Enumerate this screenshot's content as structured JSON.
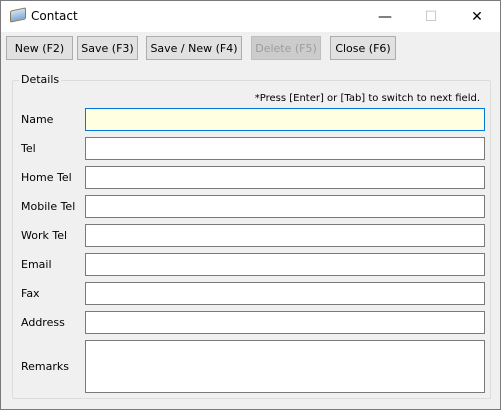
{
  "window": {
    "title": "Contact",
    "minimize": "—",
    "maximize": "☐",
    "close": "✕"
  },
  "toolbar": {
    "new": "New (F2)",
    "save": "Save (F3)",
    "save_new": "Save / New (F4)",
    "delete": "Delete (F5)",
    "close": "Close (F6)"
  },
  "details": {
    "legend": "Details",
    "hint": "*Press [Enter] or [Tab] to switch to next field.",
    "fields": [
      {
        "label": "Name",
        "value": ""
      },
      {
        "label": "Tel",
        "value": ""
      },
      {
        "label": "Home Tel",
        "value": ""
      },
      {
        "label": "Mobile Tel",
        "value": ""
      },
      {
        "label": "Work Tel",
        "value": ""
      },
      {
        "label": "Email",
        "value": ""
      },
      {
        "label": "Fax",
        "value": ""
      },
      {
        "label": "Address",
        "value": ""
      },
      {
        "label": "Remarks",
        "value": ""
      }
    ]
  },
  "colors": {
    "focus_bg": "#ffffe1",
    "focus_border": "#0078d7"
  }
}
